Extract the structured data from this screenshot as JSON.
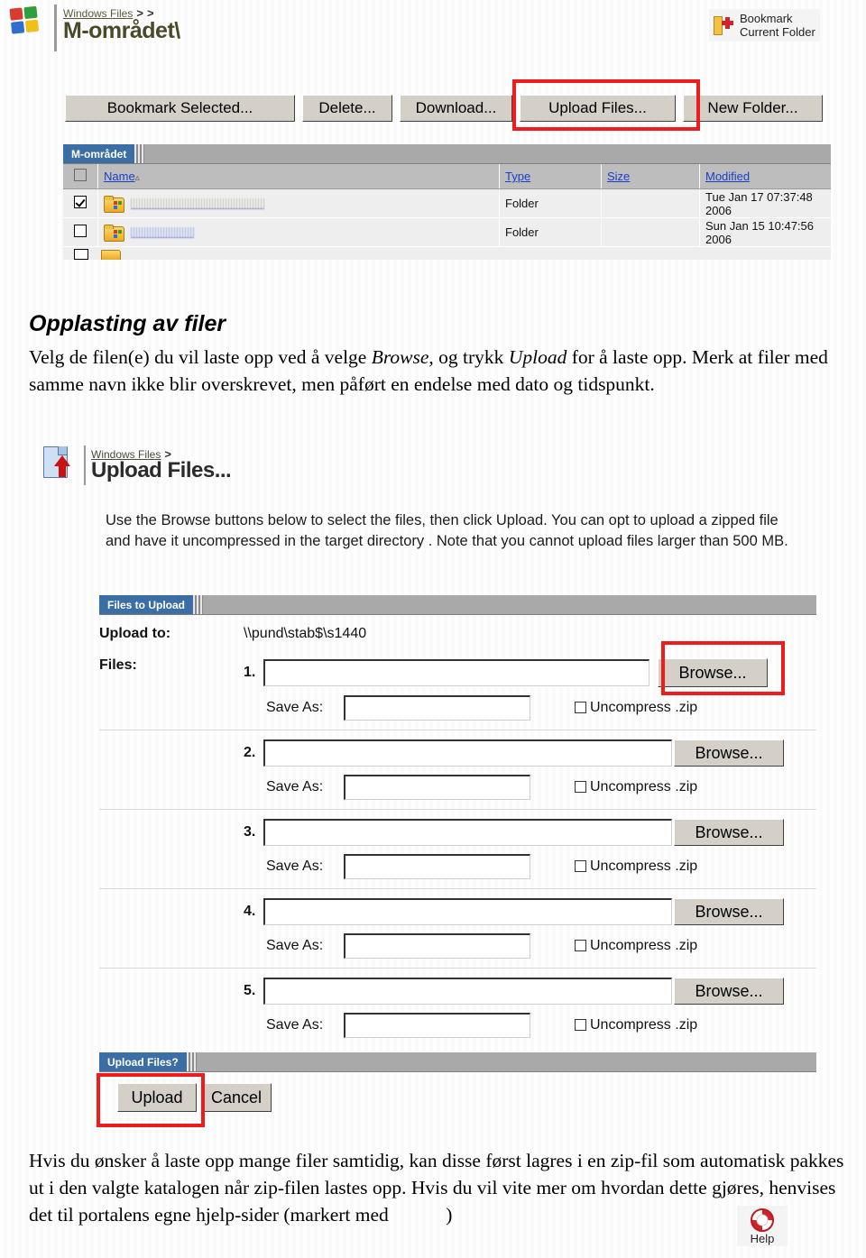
{
  "shot_top": {
    "logo_icon": "windows-logo-icon",
    "breadcrumb": {
      "link": "Windows Files",
      "sep1": ">",
      "sep2": ">"
    },
    "title": "M-området\\",
    "bookmark_button": {
      "line1": "Bookmark",
      "line2": "Current Folder",
      "icon": "bookmark-add-icon"
    },
    "toolbar": [
      {
        "label": "Bookmark Selected...",
        "name": "bookmark-selected-button"
      },
      {
        "label": "Delete...",
        "name": "delete-button"
      },
      {
        "label": "Download...",
        "name": "download-button"
      },
      {
        "label": "Upload Files...",
        "name": "upload-files-button",
        "highlighted": true
      },
      {
        "label": "New Folder...",
        "name": "new-folder-button"
      }
    ],
    "panel_tab": "M-området",
    "table": {
      "columns": [
        "",
        "Name",
        "Type",
        "Size",
        "Modified"
      ],
      "sort_column": "Name",
      "sort_direction": "ascending",
      "rows": [
        {
          "checked": true,
          "name": "",
          "type": "Folder",
          "size": "",
          "modified": "Tue Jan 17 07:37:48 2006"
        },
        {
          "checked": false,
          "name": "",
          "type": "Folder",
          "size": "",
          "modified": "Sun Jan 15 10:47:56 2006"
        }
      ]
    }
  },
  "body_text": {
    "heading": "Opplasting av filer",
    "para1_a": "Velg de filen(e) du vil laste opp ved å velge ",
    "para1_em1": "Browse",
    "para1_b": ", og trykk ",
    "para1_em2": "Upload",
    "para1_c": " for å laste opp. Merk at filer med samme navn ikke blir overskrevet, men påført en endelse med dato og tidspunkt."
  },
  "shot_bottom": {
    "icon": "upload-page-icon",
    "breadcrumb": {
      "link": "Windows Files",
      "sep": ">"
    },
    "title": "Upload Files...",
    "description": "Use the Browse buttons below to select the files, then click Upload. You can opt to upload a zipped file and have it uncompressed in the target directory . Note that you cannot upload files larger than 500 MB.",
    "panel_tab": "Files to Upload",
    "upload_to_label": "Upload to:",
    "upload_to_value": "\\\\pund\\stab$\\s1440",
    "files_label": "Files:",
    "save_as_label": "Save As:",
    "uncompress_label": "Uncompress .zip",
    "browse_label": "Browse...",
    "rows": [
      {
        "num": "1.",
        "file_value": "",
        "save_as_value": "",
        "uncompress_checked": false,
        "highlighted": true
      },
      {
        "num": "2.",
        "file_value": "",
        "save_as_value": "",
        "uncompress_checked": false,
        "highlighted": false
      },
      {
        "num": "3.",
        "file_value": "",
        "save_as_value": "",
        "uncompress_checked": false,
        "highlighted": false
      },
      {
        "num": "4.",
        "file_value": "",
        "save_as_value": "",
        "uncompress_checked": false,
        "highlighted": false
      },
      {
        "num": "5.",
        "file_value": "",
        "save_as_value": "",
        "uncompress_checked": false,
        "highlighted": false
      }
    ],
    "submit_panel_tab": "Upload Files?",
    "upload_button": "Upload",
    "cancel_button": "Cancel"
  },
  "footer_text": {
    "para_a": "Hvis du ønsker å laste opp mange filer samtidig, kan disse først lagres i en zip-fil som automatisk pakkes ut i den valgte katalogen når zip-filen lastes opp. Hvis du vil vite mer om hvordan dette gjøres, henvises det til portalens egne hjelp-sider (markert med ",
    "para_b": ")",
    "help_icon_label": "Help"
  },
  "colors": {
    "accent_blue": "#3a6ea5",
    "annotation_red": "#ee1c1c",
    "button_face": "#d4d0c8",
    "panel_gray": "#a9a9a9"
  }
}
